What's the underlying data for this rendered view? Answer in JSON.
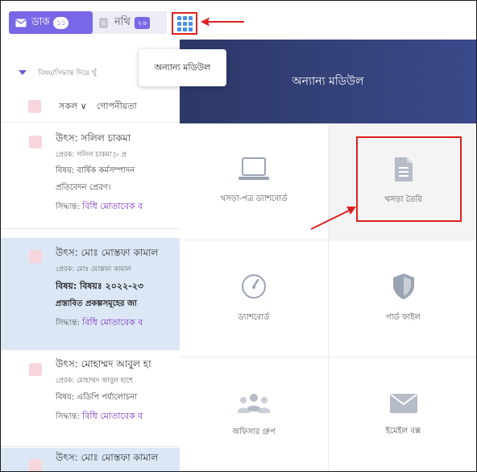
{
  "topbar": {
    "dak_label": "ডাক",
    "dak_count": "১১",
    "nothi_label": "নথি",
    "nothi_count": "২৬"
  },
  "tooltip": {
    "text": "অন্যান্য মডিউল"
  },
  "list": {
    "filter_placeholder": "বিষয়/সিদ্ধান্ত দিয়ে খুঁ",
    "tab_all": "সকল ∨",
    "tab_secret": "গোপনীয়তা",
    "items": [
      {
        "source": "উৎস: সলিল চাকমা",
        "sender": "প্রেরক: সলিল চাকমা  ▷  প্র",
        "subject": "বিষয়: বার্ষিক কর্মসম্পাদন",
        "subject2": "প্রতিবেদন প্রেরণ।",
        "decision_label": "সিদ্ধান্ত:",
        "decision": "বিধি মোতাবেক ব"
      },
      {
        "source": "উৎস: মোঃ মোস্তফা কামাল",
        "sender": "প্রেরক: মোঃ মোস্তফা কামাল",
        "subject": "বিষয়:  বিষয়ঃ ২০২২-২৩",
        "subject2": "প্রস্তাবিত প্রকল্পসমূহের জা",
        "decision_label": "সিদ্ধান্ত:",
        "decision": "বিধি মোতাবেক ব"
      },
      {
        "source": "উৎস: মোহাম্মদ আবুল হা",
        "sender": "প্রেরক: মোহাম্মদ আবুল হাশে",
        "subject": "বিষয়: এডিপি পর্যালোচনা",
        "decision_label": "সিদ্ধান্ত:",
        "decision": "বিধি মোতাবেক ব"
      },
      {
        "source": "উৎস: মোঃ মোস্তফা কামাল"
      }
    ]
  },
  "panel": {
    "title": "অন্যান্য মডিউল",
    "modules": [
      {
        "label": "খসড়া-পত্র ড্যাশবোর্ড",
        "icon": "laptop-icon"
      },
      {
        "label": "খসড়া তৈরি",
        "icon": "document-icon"
      },
      {
        "label": "ড্যাশবোর্ড",
        "icon": "gauge-icon"
      },
      {
        "label": "গার্ড ফাইল",
        "icon": "shield-icon"
      },
      {
        "label": "অফিসার গ্রুপ",
        "icon": "users-icon"
      },
      {
        "label": "ইমেইল বক্স",
        "icon": "envelope-icon"
      }
    ]
  },
  "colors": {
    "accent": "#7867e6",
    "panel_header": "#2d3867",
    "highlight": "#e02020",
    "selected_row": "#dce7f6"
  }
}
